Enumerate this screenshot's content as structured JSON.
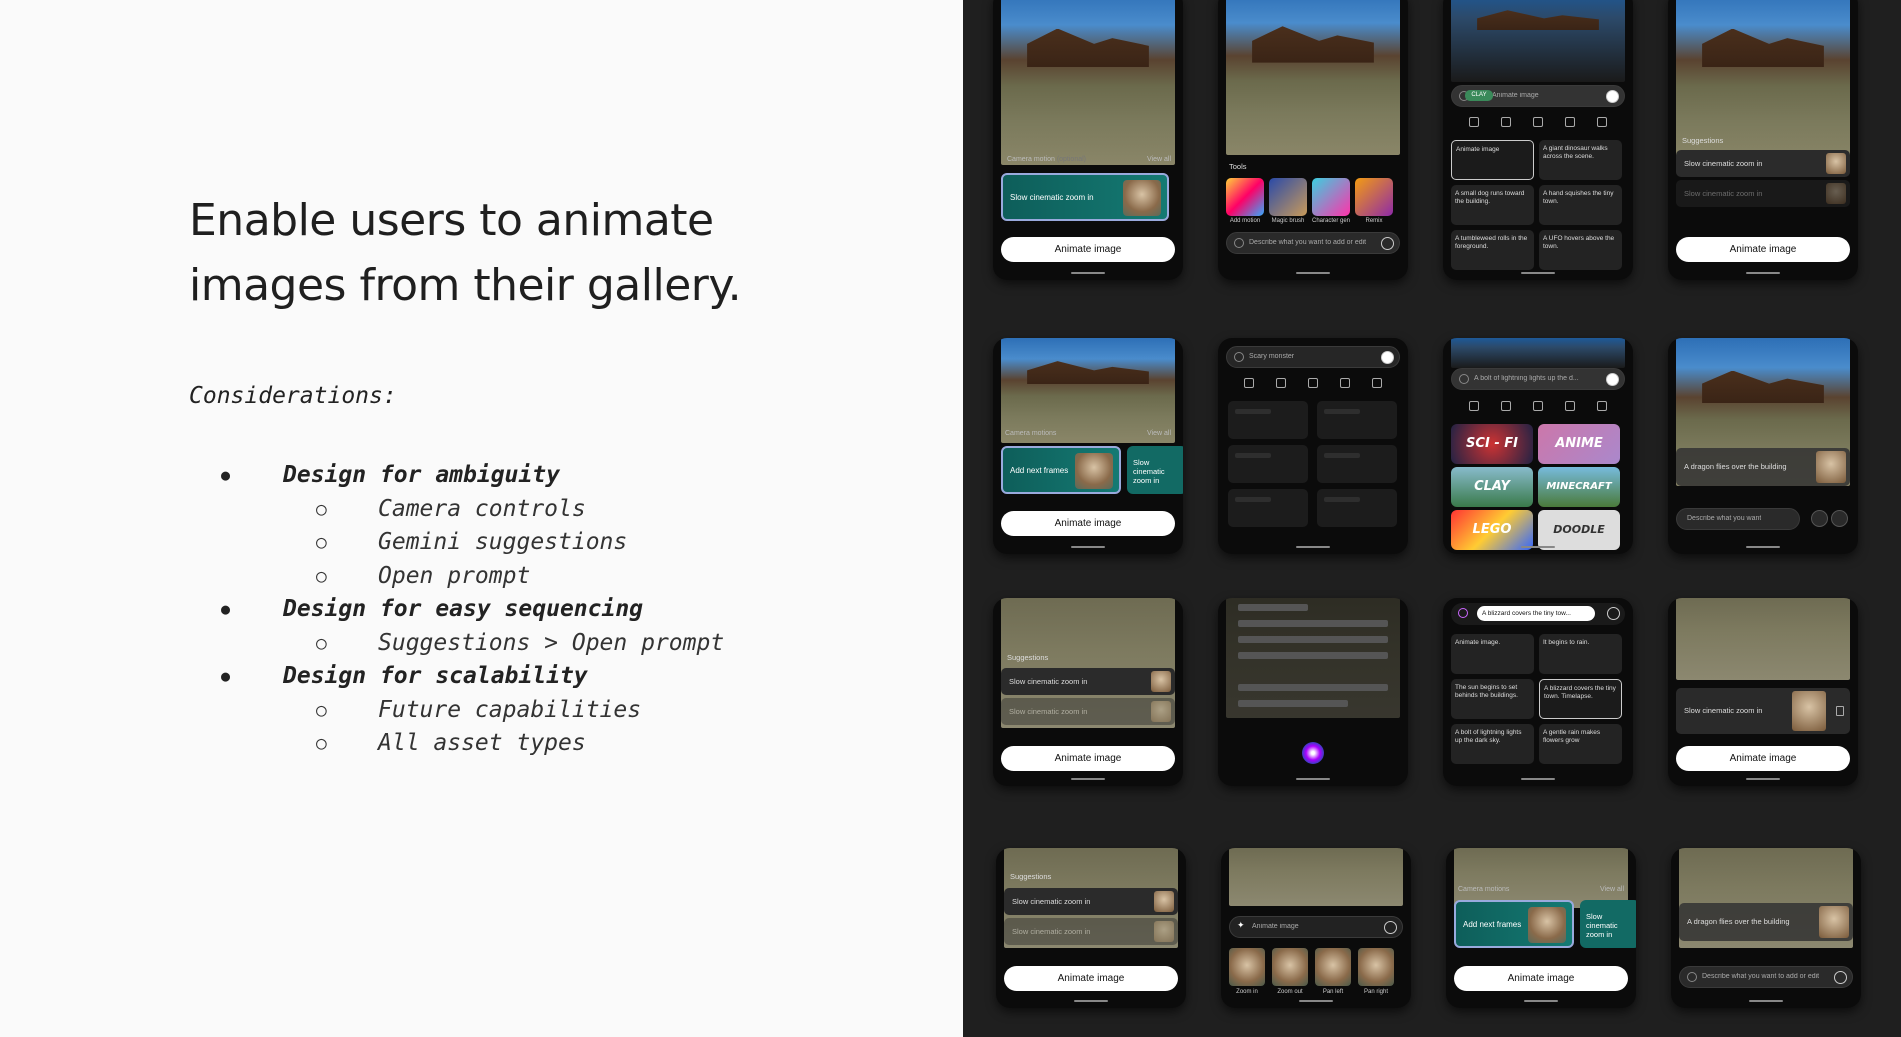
{
  "slide": {
    "title": "Enable users to animate images from their gallery.",
    "considerations_label": "Considerations:",
    "items": [
      {
        "label": "Design for ambiguity",
        "sub": [
          "Camera controls",
          "Gemini suggestions",
          "Open prompt"
        ]
      },
      {
        "label": "Design for easy sequencing",
        "sub": [
          "Suggestions > Open prompt"
        ]
      },
      {
        "label": "Design for scalability",
        "sub": [
          "Future capabilities",
          "All asset types"
        ]
      }
    ]
  },
  "mockups": {
    "animate_image": "Animate image",
    "camera_motion": "Camera motion",
    "camera_motion_optional": "(optional)",
    "camera_motions": "Camera motions",
    "view_all": "View all",
    "slow_zoom": "Slow cinematic zoom in",
    "add_next_frames": "Add next frames",
    "suggestions": "Suggestions",
    "tools": "Tools",
    "tool_labels": [
      "Add motion",
      "Magic brush",
      "Character gen",
      "Remix"
    ],
    "describe_add_edit": "Describe what you want to add or edit",
    "describe_want": "Describe what you want",
    "scary_monster": "Scary monster",
    "lightning_prompt": "A bolt of lightning lights up the d...",
    "blizzard_prompt": "A blizzard covers the tiny tow...",
    "dragon": "A dragon flies over the building",
    "clay_chip": "CLAY",
    "prompts_a": [
      "Animate image",
      "A giant dinosaur walks across the scene.",
      "A small dog runs toward the building.",
      "A hand squishes the tiny town.",
      "A tumbleweed rolls in the foreground.",
      "A UFO hovers above the town."
    ],
    "prompts_b": [
      "Animate image.",
      "It begins to rain.",
      "The sun begins to set behinds the buildings.",
      "A blizzard covers the tiny town. Timelapse.",
      "A bolt of lightning lights up the dark sky.",
      "A gentle rain makes flowers grow"
    ],
    "styles": [
      "SCI - FI",
      "ANIME",
      "CLAY",
      "MINECRAFT",
      "LEGO",
      "DOODLE"
    ],
    "zoom_labels": [
      "Zoom in",
      "Zoom out",
      "Pan left",
      "Pan right"
    ]
  }
}
